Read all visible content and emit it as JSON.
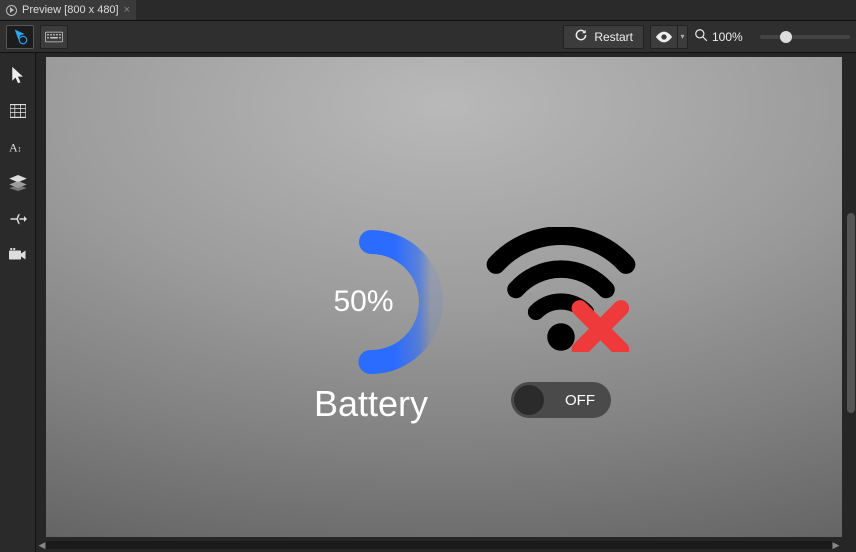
{
  "tab": {
    "title": "Preview [800 x 480]"
  },
  "toolbar": {
    "restart_label": "Restart",
    "zoom_value": "100%"
  },
  "preview": {
    "battery": {
      "percent_label": "50%",
      "caption": "Battery",
      "percent_value": 50
    },
    "wifi": {
      "toggle_label": "OFF",
      "toggle_state": "off"
    }
  },
  "colors": {
    "gauge_arc": "#2b6cff",
    "wifi_x": "#ee3a3a"
  }
}
